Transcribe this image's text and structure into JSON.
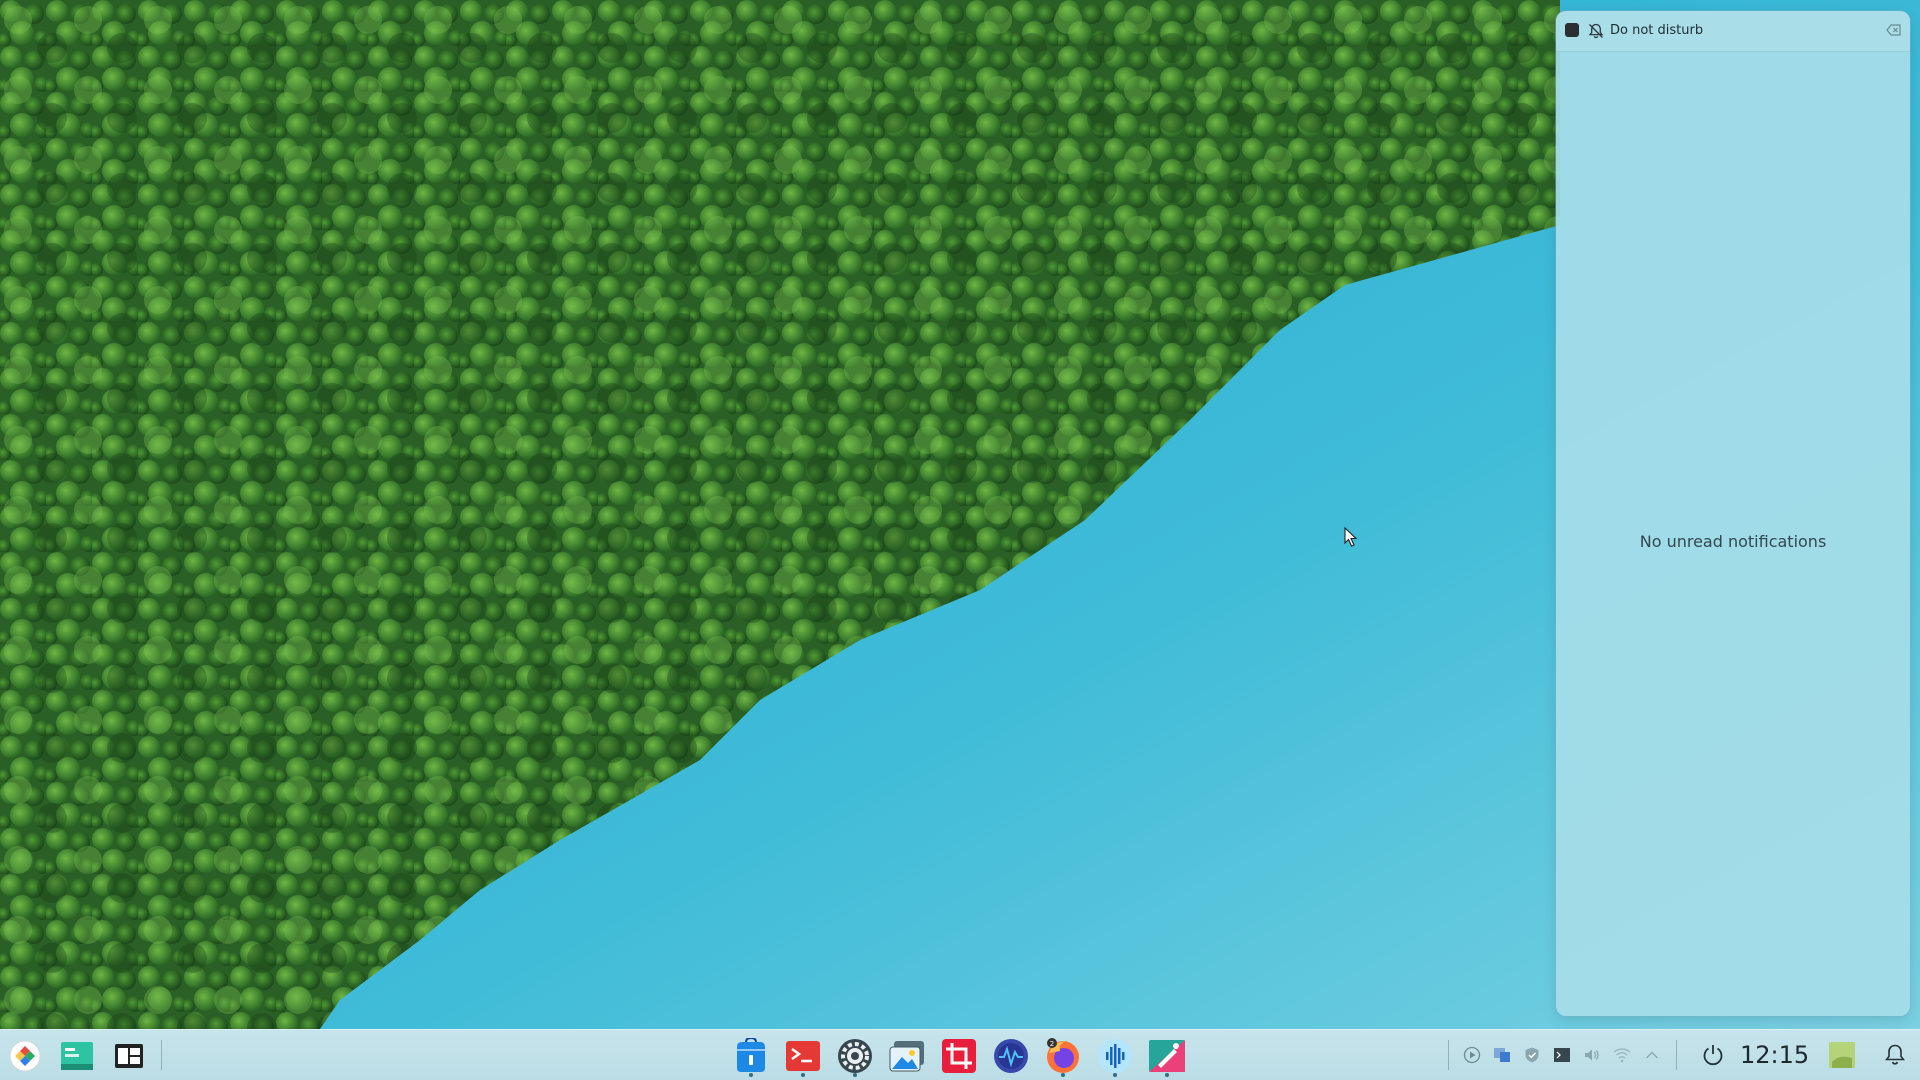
{
  "notifications": {
    "dnd_label": "Do not disturb",
    "empty_message": "No unread notifications"
  },
  "taskbar": {
    "launchers": [
      {
        "icon": "app-launcher-icon"
      },
      {
        "icon": "peek-at-desktop-icon"
      },
      {
        "icon": "overview-icon"
      }
    ],
    "tasks": [
      {
        "icon": "discover-store-icon",
        "running": true
      },
      {
        "icon": "terminal-icon",
        "running": true
      },
      {
        "icon": "system-settings-icon",
        "running": true
      },
      {
        "icon": "image-viewer-icon",
        "running": false
      },
      {
        "icon": "crop-tool-icon",
        "running": false
      },
      {
        "icon": "system-monitor-icon",
        "running": false
      },
      {
        "icon": "firefox-icon",
        "running": true
      },
      {
        "icon": "audio-recorder-icon",
        "running": true
      },
      {
        "icon": "drawing-app-icon",
        "running": true
      }
    ],
    "tray": [
      "media-player-icon",
      "kde-connect-icon",
      "vault-icon",
      "display-icon",
      "volume-icon",
      "network-icon",
      "expand-tray-icon"
    ],
    "clock": "12:15"
  },
  "colors": {
    "water": "#2fb2d3",
    "forest": "#2f6b2a",
    "panel": "#a6dde8"
  }
}
